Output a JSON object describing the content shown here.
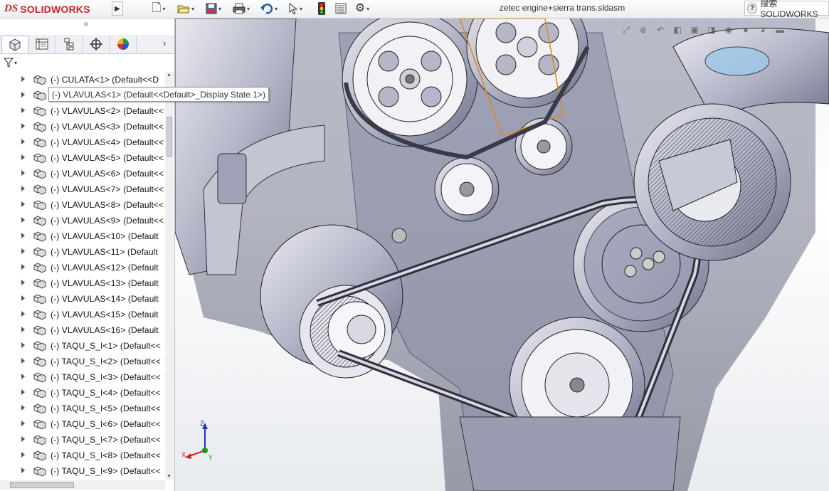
{
  "app": {
    "logo_ds": "DS",
    "logo_brand": "SOLIDWORKS",
    "document_title": "zetec engine+sierra trans.sldasm",
    "search_label": "搜索 SOLIDWORKS"
  },
  "toolbar": {
    "icons": [
      "new-document-icon",
      "open-folder-icon",
      "save-icon",
      "print-icon",
      "undo-icon",
      "select-arrow-icon",
      "rebuild-traffic-light-icon",
      "file-properties-icon",
      "options-gear-icon"
    ]
  },
  "panel": {
    "tabs": [
      "featuremanager-tab",
      "propertymanager-tab",
      "configurationmanager-tab",
      "dimxpert-tab",
      "display-manager-tab"
    ],
    "tooltip": "(-) VLAVULAS<1> (Default<<Default>_Display State 1>)",
    "tree_items": [
      "(-) CULATA<1> (Default<<D",
      "(-) VLAVULAS<1> (Default<<",
      "(-) VLAVULAS<2> (Default<<",
      "(-) VLAVULAS<3> (Default<<",
      "(-) VLAVULAS<4> (Default<<",
      "(-) VLAVULAS<5> (Default<<",
      "(-) VLAVULAS<6> (Default<<",
      "(-) VLAVULAS<7> (Default<<",
      "(-) VLAVULAS<8> (Default<<",
      "(-) VLAVULAS<9> (Default<<",
      "(-) VLAVULAS<10> (Default",
      "(-) VLAVULAS<11> (Default",
      "(-) VLAVULAS<12> (Default",
      "(-) VLAVULAS<13> (Default",
      "(-) VLAVULAS<14> (Default",
      "(-) VLAVULAS<15> (Default",
      "(-) VLAVULAS<16> (Default",
      "(-) TAQU_S_I<1> (Default<<",
      "(-) TAQU_S_I<2> (Default<<",
      "(-) TAQU_S_I<3> (Default<<",
      "(-) TAQU_S_I<4> (Default<<",
      "(-) TAQU_S_I<5> (Default<<",
      "(-) TAQU_S_I<6> (Default<<",
      "(-) TAQU_S_I<7> (Default<<",
      "(-) TAQU_S_I<8> (Default<<",
      "(-) TAQU_S_I<9> (Default<<"
    ]
  },
  "viewport": {
    "triad": {
      "x_label": "X",
      "y_label": "Y",
      "z_label": "Z"
    },
    "colors": {
      "x_axis": "#d42020",
      "y_axis": "#1a9a1a",
      "z_axis": "#2030d0",
      "background_top": "#f3f4f6",
      "background_bottom": "#e8ebef"
    }
  }
}
